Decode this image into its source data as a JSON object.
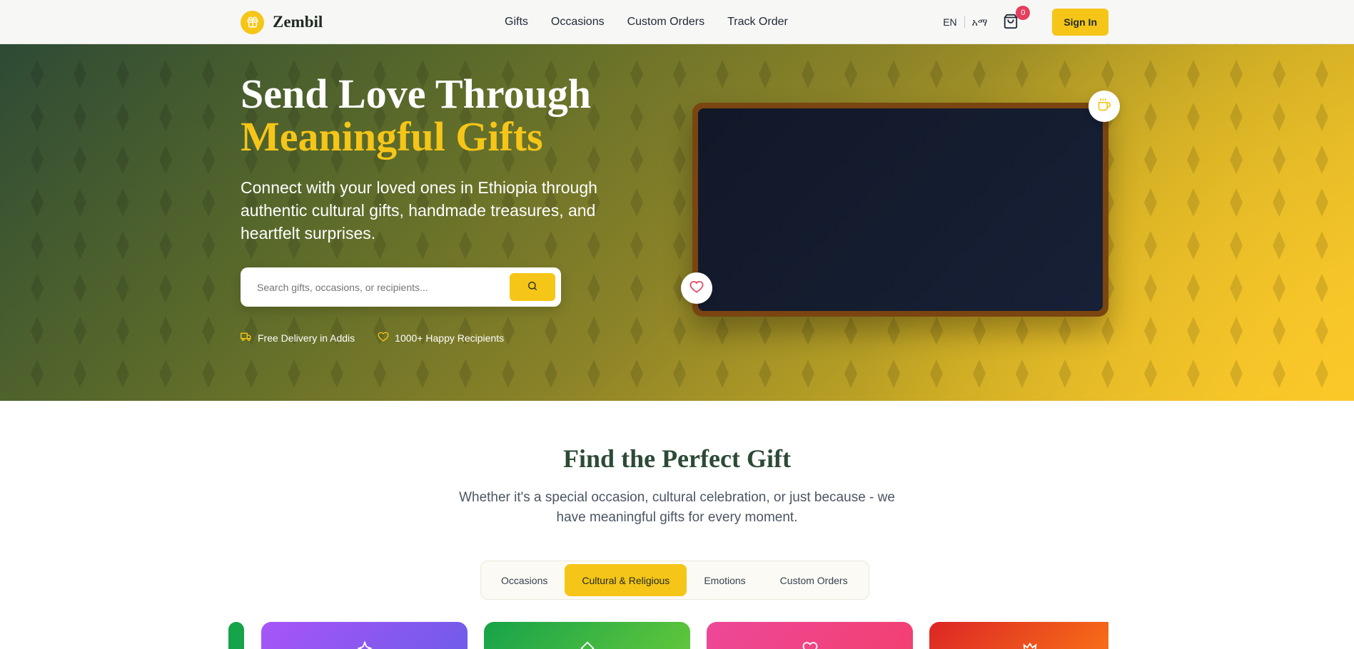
{
  "brand": {
    "name": "Zembil"
  },
  "nav": {
    "links": [
      "Gifts",
      "Occasions",
      "Custom Orders",
      "Track Order"
    ],
    "lang_en": "EN",
    "lang_am": "አማ",
    "cart_count": "0",
    "signin_label": "Sign In"
  },
  "hero": {
    "title_line1": "Send Love Through",
    "title_line2": "Meaningful Gifts",
    "subtitle": "Connect with your loved ones in Ethiopia through authentic cultural gifts, handmade treasures, and heartfelt surprises.",
    "search_placeholder": "Search gifts, occasions, or recipients...",
    "badge_delivery": "Free Delivery in Addis",
    "badge_recipients": "1000+ Happy Recipients"
  },
  "find": {
    "title": "Find the Perfect Gift",
    "subtitle": "Whether it's a special occasion, cultural celebration, or just because - we have meaningful gifts for every moment.",
    "tabs": [
      "Occasions",
      "Cultural & Religious",
      "Emotions",
      "Custom Orders"
    ],
    "active_tab": "Cultural & Religious"
  },
  "colors": {
    "accent": "#f5c518",
    "brand_green": "#2d4a35",
    "cart_badge": "#e53e5e",
    "card1": "#8b5cf6",
    "card2": "#22c55e",
    "card3": "#ec4899",
    "card4": "#ef4444"
  },
  "icons": {
    "logo": "gift-icon",
    "cart": "shopping-bag-icon",
    "search": "search-icon",
    "delivery": "truck-icon",
    "recipients": "heart-icon",
    "frame_top": "coffee-icon",
    "frame_bottom": "heart-icon"
  }
}
